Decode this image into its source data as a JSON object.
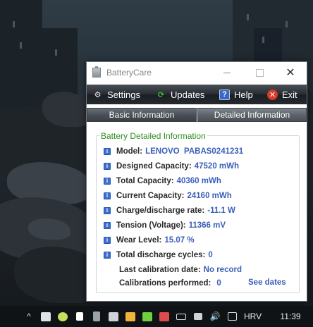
{
  "window": {
    "title": "BatteryCare",
    "close_glyph": "✕"
  },
  "toolbar": {
    "settings_label": "Settings",
    "updates_label": "Updates",
    "help_label": "Help",
    "exit_label": "Exit"
  },
  "tabs": {
    "basic_label": "Basic Information",
    "detailed_label": "Detailed Information"
  },
  "details": {
    "group_title": "Battery Detailed Information",
    "rows": [
      {
        "label": "Model:",
        "value": "LENOVO  PABAS0241231"
      },
      {
        "label": "Designed Capacity:",
        "value": "47520 mWh"
      },
      {
        "label": "Total Capacity:",
        "value": "40360 mWh"
      },
      {
        "label": "Current Capacity:",
        "value": "24160 mWh"
      },
      {
        "label": "Charge/discharge rate:",
        "value": "-11.1 W"
      },
      {
        "label": "Tension (Voltage):",
        "value": "11366 mV"
      },
      {
        "label": "Wear Level:",
        "value": "15.07 %"
      },
      {
        "label": "Total discharge cycles:",
        "value": "0"
      }
    ],
    "last_calibration_label": "Last calibration date:",
    "last_calibration_value": "No record",
    "calibrations_performed_label": "Calibrations performed:",
    "calibrations_performed_value": "0",
    "see_dates_link": "See dates"
  },
  "taskbar": {
    "overflow_glyph": "^",
    "language": "HRV",
    "time": "11:39"
  },
  "colors": {
    "value_blue": "#3a5fb8",
    "group_title_green": "#2d8f23",
    "info_icon_blue": "#3a6fcf",
    "exit_red": "#d83a2a",
    "updates_green": "#3fbf2f"
  }
}
